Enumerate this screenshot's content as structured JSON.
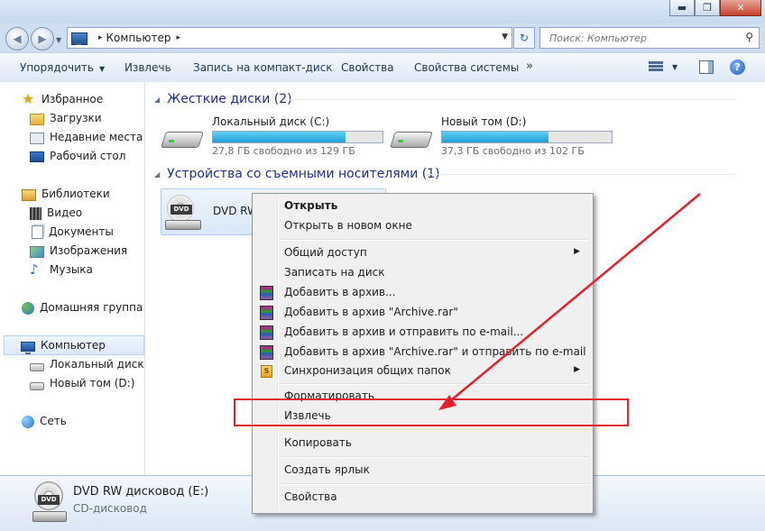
{
  "window": {
    "minimize": "▬",
    "maximize": "❐",
    "close": "✕"
  },
  "address": {
    "back": "◀",
    "forward": "▶",
    "separator": "▸",
    "crumb": "Компьютер",
    "refresh": "↻",
    "search_placeholder": "Поиск: Компьютер"
  },
  "toolbar": {
    "organize": "Упорядочить",
    "eject": "Извлечь",
    "burn": "Запись на компакт-диск",
    "properties": "Свойства",
    "system_properties": "Свойства системы",
    "more": "»"
  },
  "nav": {
    "favorites": "Избранное",
    "downloads": "Загрузки",
    "recent": "Недавние места",
    "desktop": "Рабочий стол",
    "libraries": "Библиотеки",
    "video": "Видео",
    "documents": "Документы",
    "images": "Изображения",
    "music": "Музыка",
    "homegroup": "Домашняя группа",
    "computer": "Компьютер",
    "local_disk": "Локальный диск (С",
    "new_volume": "Новый том (D:)",
    "network": "Сеть"
  },
  "content": {
    "hard_disks_header": "Жесткие диски (2)",
    "removable_header": "Устройства со съемными носителями (1)",
    "drives": [
      {
        "name": "Локальный диск (C:)",
        "free": "27,8 ГБ свободно из 129 ГБ",
        "used_fraction": 0.78
      },
      {
        "name": "Новый том (D:)",
        "free": "37,3 ГБ свободно из 102 ГБ",
        "used_fraction": 0.63
      }
    ],
    "dvd_name": "DVD RW",
    "dvd_badge": "DVD"
  },
  "context_menu": {
    "open": "Открыть",
    "open_new_window": "Открыть в новом окне",
    "share": "Общий доступ",
    "burn": "Записать на диск",
    "add_archive": "Добавить в архив...",
    "add_archive_rar": "Добавить в архив \"Archive.rar\"",
    "add_archive_email": "Добавить в архив и отправить по e-mail...",
    "add_archive_rar_email": "Добавить в архив \"Archive.rar\" и отправить по e-mail",
    "sync": "Синхронизация общих папок",
    "sync_badge": "S",
    "format": "Форматировать",
    "eject": "Извлечь",
    "copy": "Копировать",
    "create_shortcut": "Создать ярлык",
    "properties": "Свойства",
    "submenu_arrow": "▶"
  },
  "details": {
    "title": "DVD RW дисковод (E:)",
    "subtitle": "CD-дисковод",
    "badge": "DVD"
  },
  "colors": {
    "annotation": "#e3202e",
    "header_text": "#1e3287",
    "bar_fill": "#1f9fd8"
  }
}
